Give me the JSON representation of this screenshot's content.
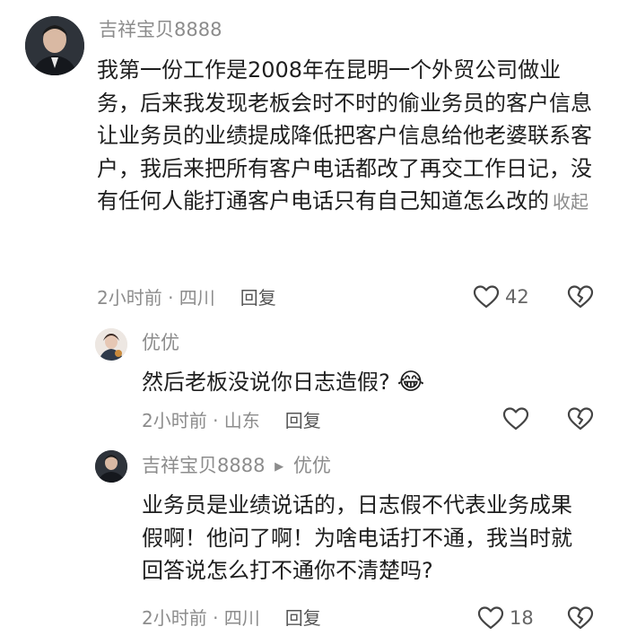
{
  "comments": [
    {
      "username": "吉祥宝贝8888",
      "text": "我第一份工作是2008年在昆明一个外贸公司做业务，后来我发现老板会时不时的偷业务员的客户信息让业务员的业绩提成降低把客户信息给他老婆联系客户，我后来把所有客户电话都改了再交工作日记，没有任何人能打通客户电话只有自己知道怎么改的",
      "collapse_label": "收起",
      "meta": "2小时前 · 四川",
      "reply_label": "回复",
      "like_count": "42"
    }
  ],
  "replies": [
    {
      "username": "优优",
      "text": "然后老板没说你日志造假?",
      "emoji": "😂",
      "meta": "2小时前 · 山东",
      "reply_label": "回复",
      "like_count": ""
    },
    {
      "username": "吉祥宝贝8888",
      "reply_arrow": "▶",
      "reply_to": "优优",
      "text": "业务员是业绩说话的，日志假不代表业务成果假啊！他问了啊！为啥电话打不通，我当时就回答说怎么打不通你不清楚吗?",
      "meta": "2小时前 · 四川",
      "reply_label": "回复",
      "like_count": "18"
    }
  ]
}
